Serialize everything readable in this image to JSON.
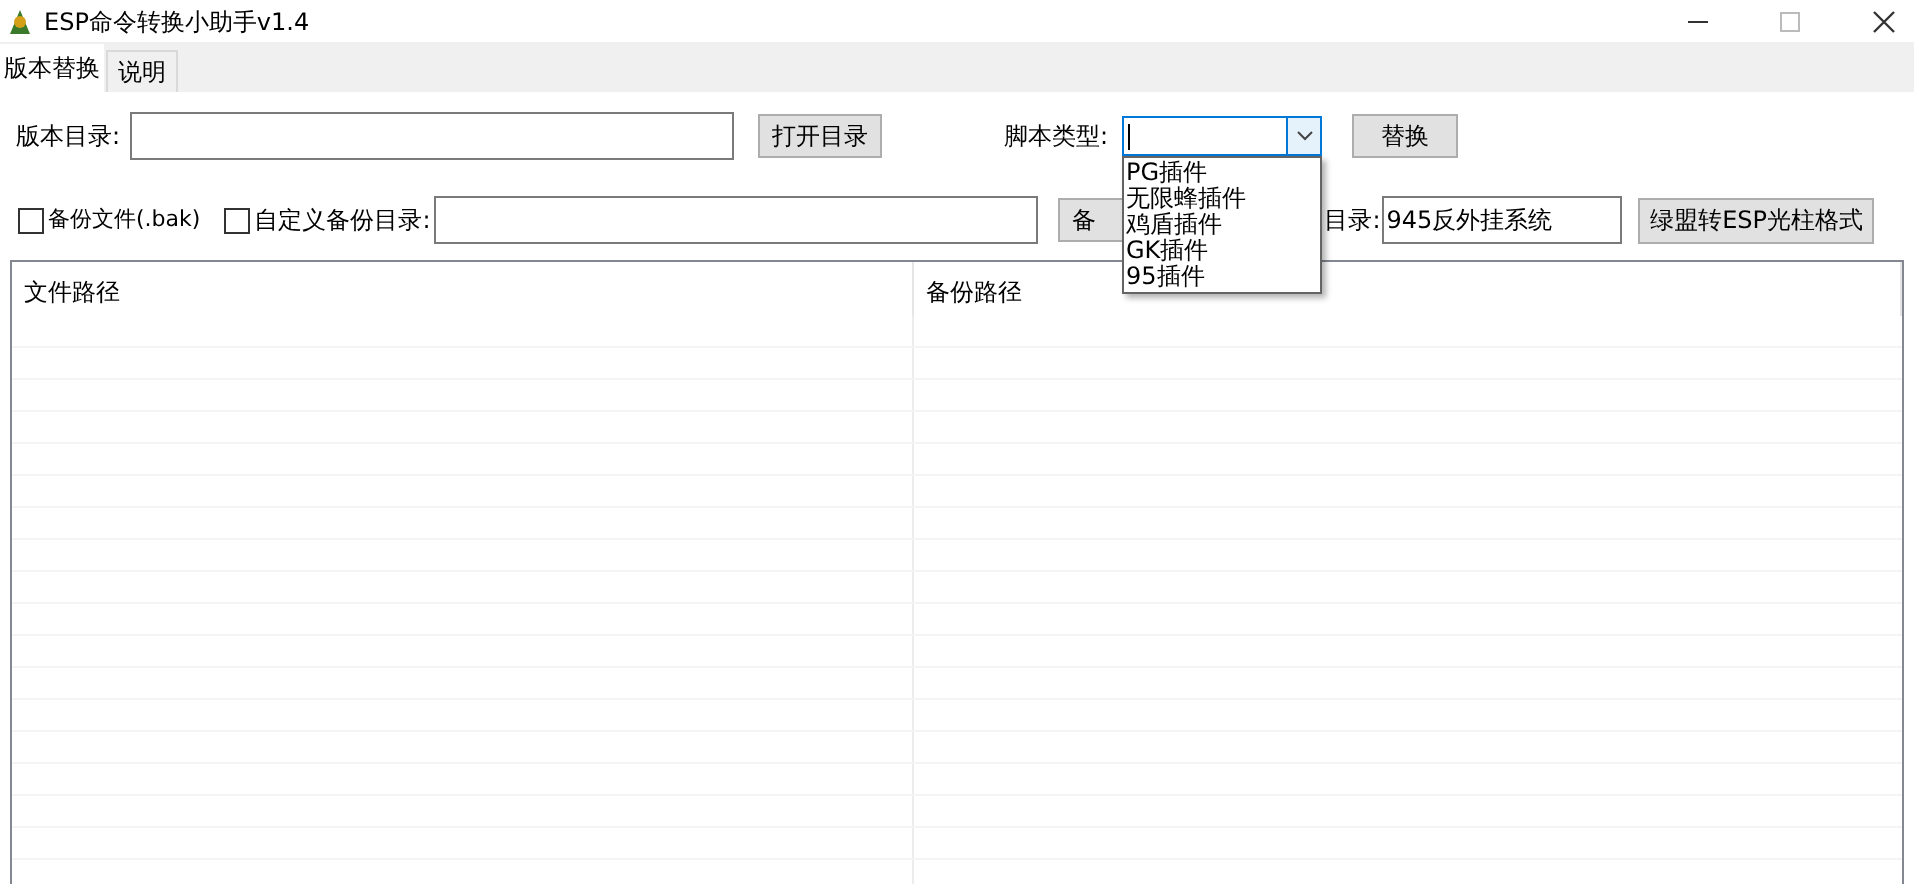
{
  "window": {
    "title": "ESP命令转换小助手v1.4"
  },
  "tabs": [
    {
      "label": "版本替换",
      "selected": true
    },
    {
      "label": "说明",
      "selected": false
    }
  ],
  "version_dir": {
    "label": "版本目录:",
    "button": "打开目录"
  },
  "script_type": {
    "label": "脚本类型:",
    "expanded": true,
    "options": [
      "PG插件",
      "无限蜂插件",
      "鸡盾插件",
      "GK插件",
      "95插件"
    ],
    "button": "替换"
  },
  "backup_file": {
    "label": "备份文件(.bak)",
    "checked": false
  },
  "custom_backup": {
    "label": "自定义备份目录:",
    "checked": false,
    "button": "备"
  },
  "target_dir": {
    "label": "目录:",
    "value": "945反外挂系统",
    "button": "绿盟转ESP光柱格式"
  },
  "table": {
    "columns": [
      "文件路径",
      "备份路径"
    ]
  }
}
